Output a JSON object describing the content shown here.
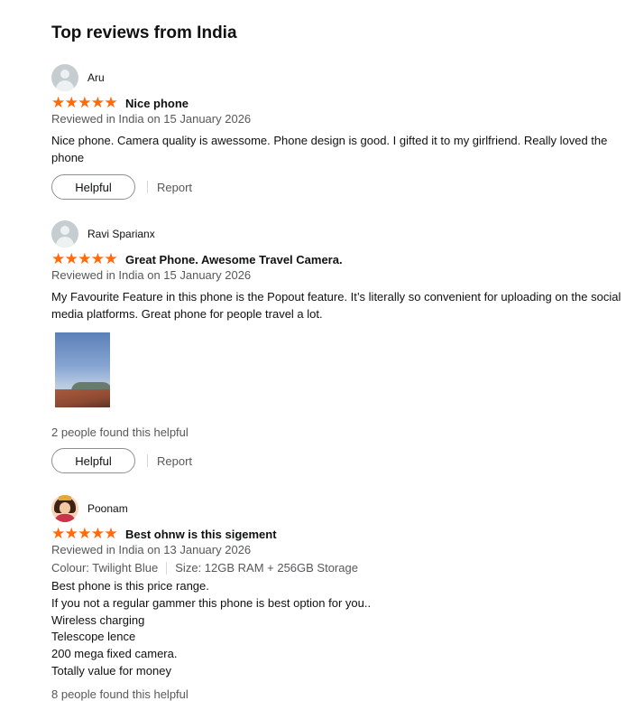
{
  "section": {
    "title": "Top reviews from India"
  },
  "reviews": [
    {
      "name": "Aru",
      "avatar": "default-avatar-icon",
      "rating": 5,
      "title": "Nice phone",
      "date": "Reviewed in India on 15 January 2026",
      "body": "Nice phone. Camera quality is awessome. Phone design is good. I gifted it to my girlfriend. Really loved the phone",
      "helpful_label": "Helpful",
      "report_label": "Report"
    },
    {
      "name": "Ravi Sparianx",
      "avatar": "default-avatar-icon",
      "rating": 5,
      "title": "Great Phone. Awesome Travel Camera.",
      "date": "Reviewed in India on 15 January 2026",
      "body": "My Favourite Feature in this phone is the Popout feature. It’s literally so convenient for uploading on the social media platforms. Great phone for people travel a lot.",
      "helpful_count": "2 people found this helpful",
      "helpful_label": "Helpful",
      "report_label": "Report"
    },
    {
      "name": "Poonam",
      "avatar": "profile-photo",
      "rating": 5,
      "title": "Best ohnw is this sigement",
      "date": "Reviewed in India on 13 January 2026",
      "colour": "Colour: Twilight Blue",
      "size": "Size: 12GB RAM + 256GB Storage",
      "lines": [
        "Best phone is this price range.",
        "If you not a regular gammer this phone is best option for you..",
        "Wireless charging",
        "Telescope lence",
        "200 mega fixed camera.",
        "Totally value for money"
      ],
      "helpful_count": "8 people found this helpful"
    }
  ],
  "colors": {
    "star": "#ff6a0b",
    "muted": "#565959",
    "text": "#0f1111"
  }
}
